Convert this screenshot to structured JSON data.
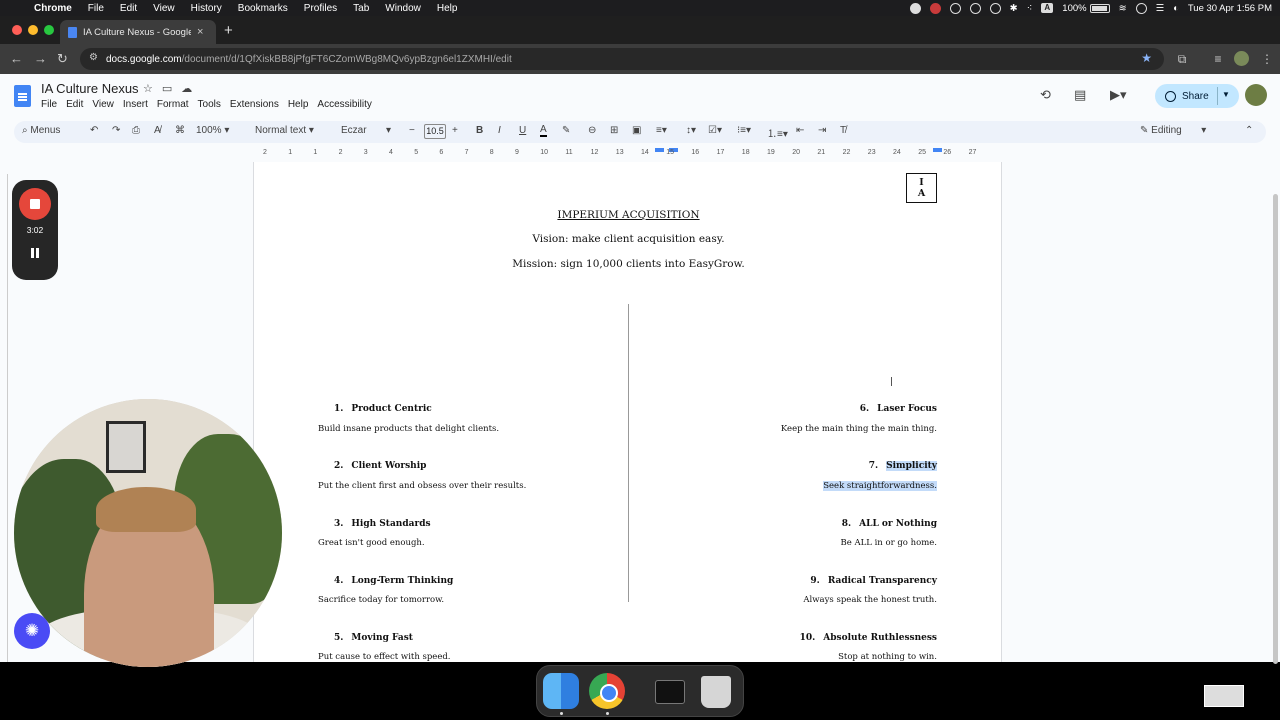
{
  "menubar": {
    "items": [
      "Chrome",
      "File",
      "Edit",
      "View",
      "History",
      "Bookmarks",
      "Profiles",
      "Tab",
      "Window",
      "Help"
    ],
    "battery": "100%",
    "battery_icon": "battery-icon",
    "input_source": "A",
    "datetime": "Tue 30 Apr  1:56 PM"
  },
  "browser": {
    "tab_title": "IA Culture Nexus - Google Docs",
    "url_host": "docs.google.com",
    "url_path": "/document/d/1QfXiskBB8jPfgFT6CZomWBg8MQv6ypBzgn6el1ZXMHI/edit"
  },
  "docs": {
    "title": "IA Culture Nexus",
    "menu": [
      "File",
      "Edit",
      "View",
      "Insert",
      "Format",
      "Tools",
      "Extensions",
      "Help",
      "Accessibility"
    ],
    "share_label": "Share",
    "toolbar": {
      "search": "Menus",
      "zoom": "100%",
      "style": "Normal text",
      "font": "Eczar",
      "font_size": "10.5",
      "mode": "Editing"
    }
  },
  "ruler": [
    "2",
    "1",
    "1",
    "2",
    "3",
    "4",
    "5",
    "6",
    "7",
    "8",
    "9",
    "10",
    "11",
    "12",
    "13",
    "14",
    "15",
    "16",
    "17",
    "18",
    "19",
    "20",
    "21",
    "22",
    "23",
    "24",
    "25",
    "26",
    "27"
  ],
  "document": {
    "logo": [
      "I",
      "A"
    ],
    "company": "IMPERIUM ACQUISITION",
    "vision": "Vision: make client acquisition easy.",
    "mission": "Mission: sign 10,000 clients into EasyGrow.",
    "left_values": [
      {
        "num": "1.",
        "title": "Product Centric",
        "desc": "Build insane products that delight clients."
      },
      {
        "num": "2.",
        "title": "Client Worship",
        "desc": "Put the client first and obsess over their results."
      },
      {
        "num": "3.",
        "title": "High Standards",
        "desc": "Great isn't good enough."
      },
      {
        "num": "4.",
        "title": "Long-Term Thinking",
        "desc": "Sacrifice today for tomorrow."
      },
      {
        "num": "5.",
        "title": "Moving Fast",
        "desc": "Put cause to effect with speed."
      }
    ],
    "right_values": [
      {
        "num": "6.",
        "title": "Laser Focus",
        "desc": "Keep the main thing the main thing."
      },
      {
        "num": "7.",
        "title": "Simplicity",
        "desc": "Seek straightforwardness."
      },
      {
        "num": "8.",
        "title": "ALL or Nothing",
        "desc": "Be ALL in or go home."
      },
      {
        "num": "9.",
        "title": "Radical Transparency",
        "desc": "Always speak the honest truth."
      },
      {
        "num": "10.",
        "title": "Absolute Ruthlessness",
        "desc": "Stop at nothing to win."
      }
    ]
  },
  "recorder": {
    "time": "3:02"
  },
  "colors": {
    "accent": "#4285f4",
    "share_bg": "#c2e7ff",
    "highlight": "#c3dbf9",
    "record": "#e5473b"
  }
}
